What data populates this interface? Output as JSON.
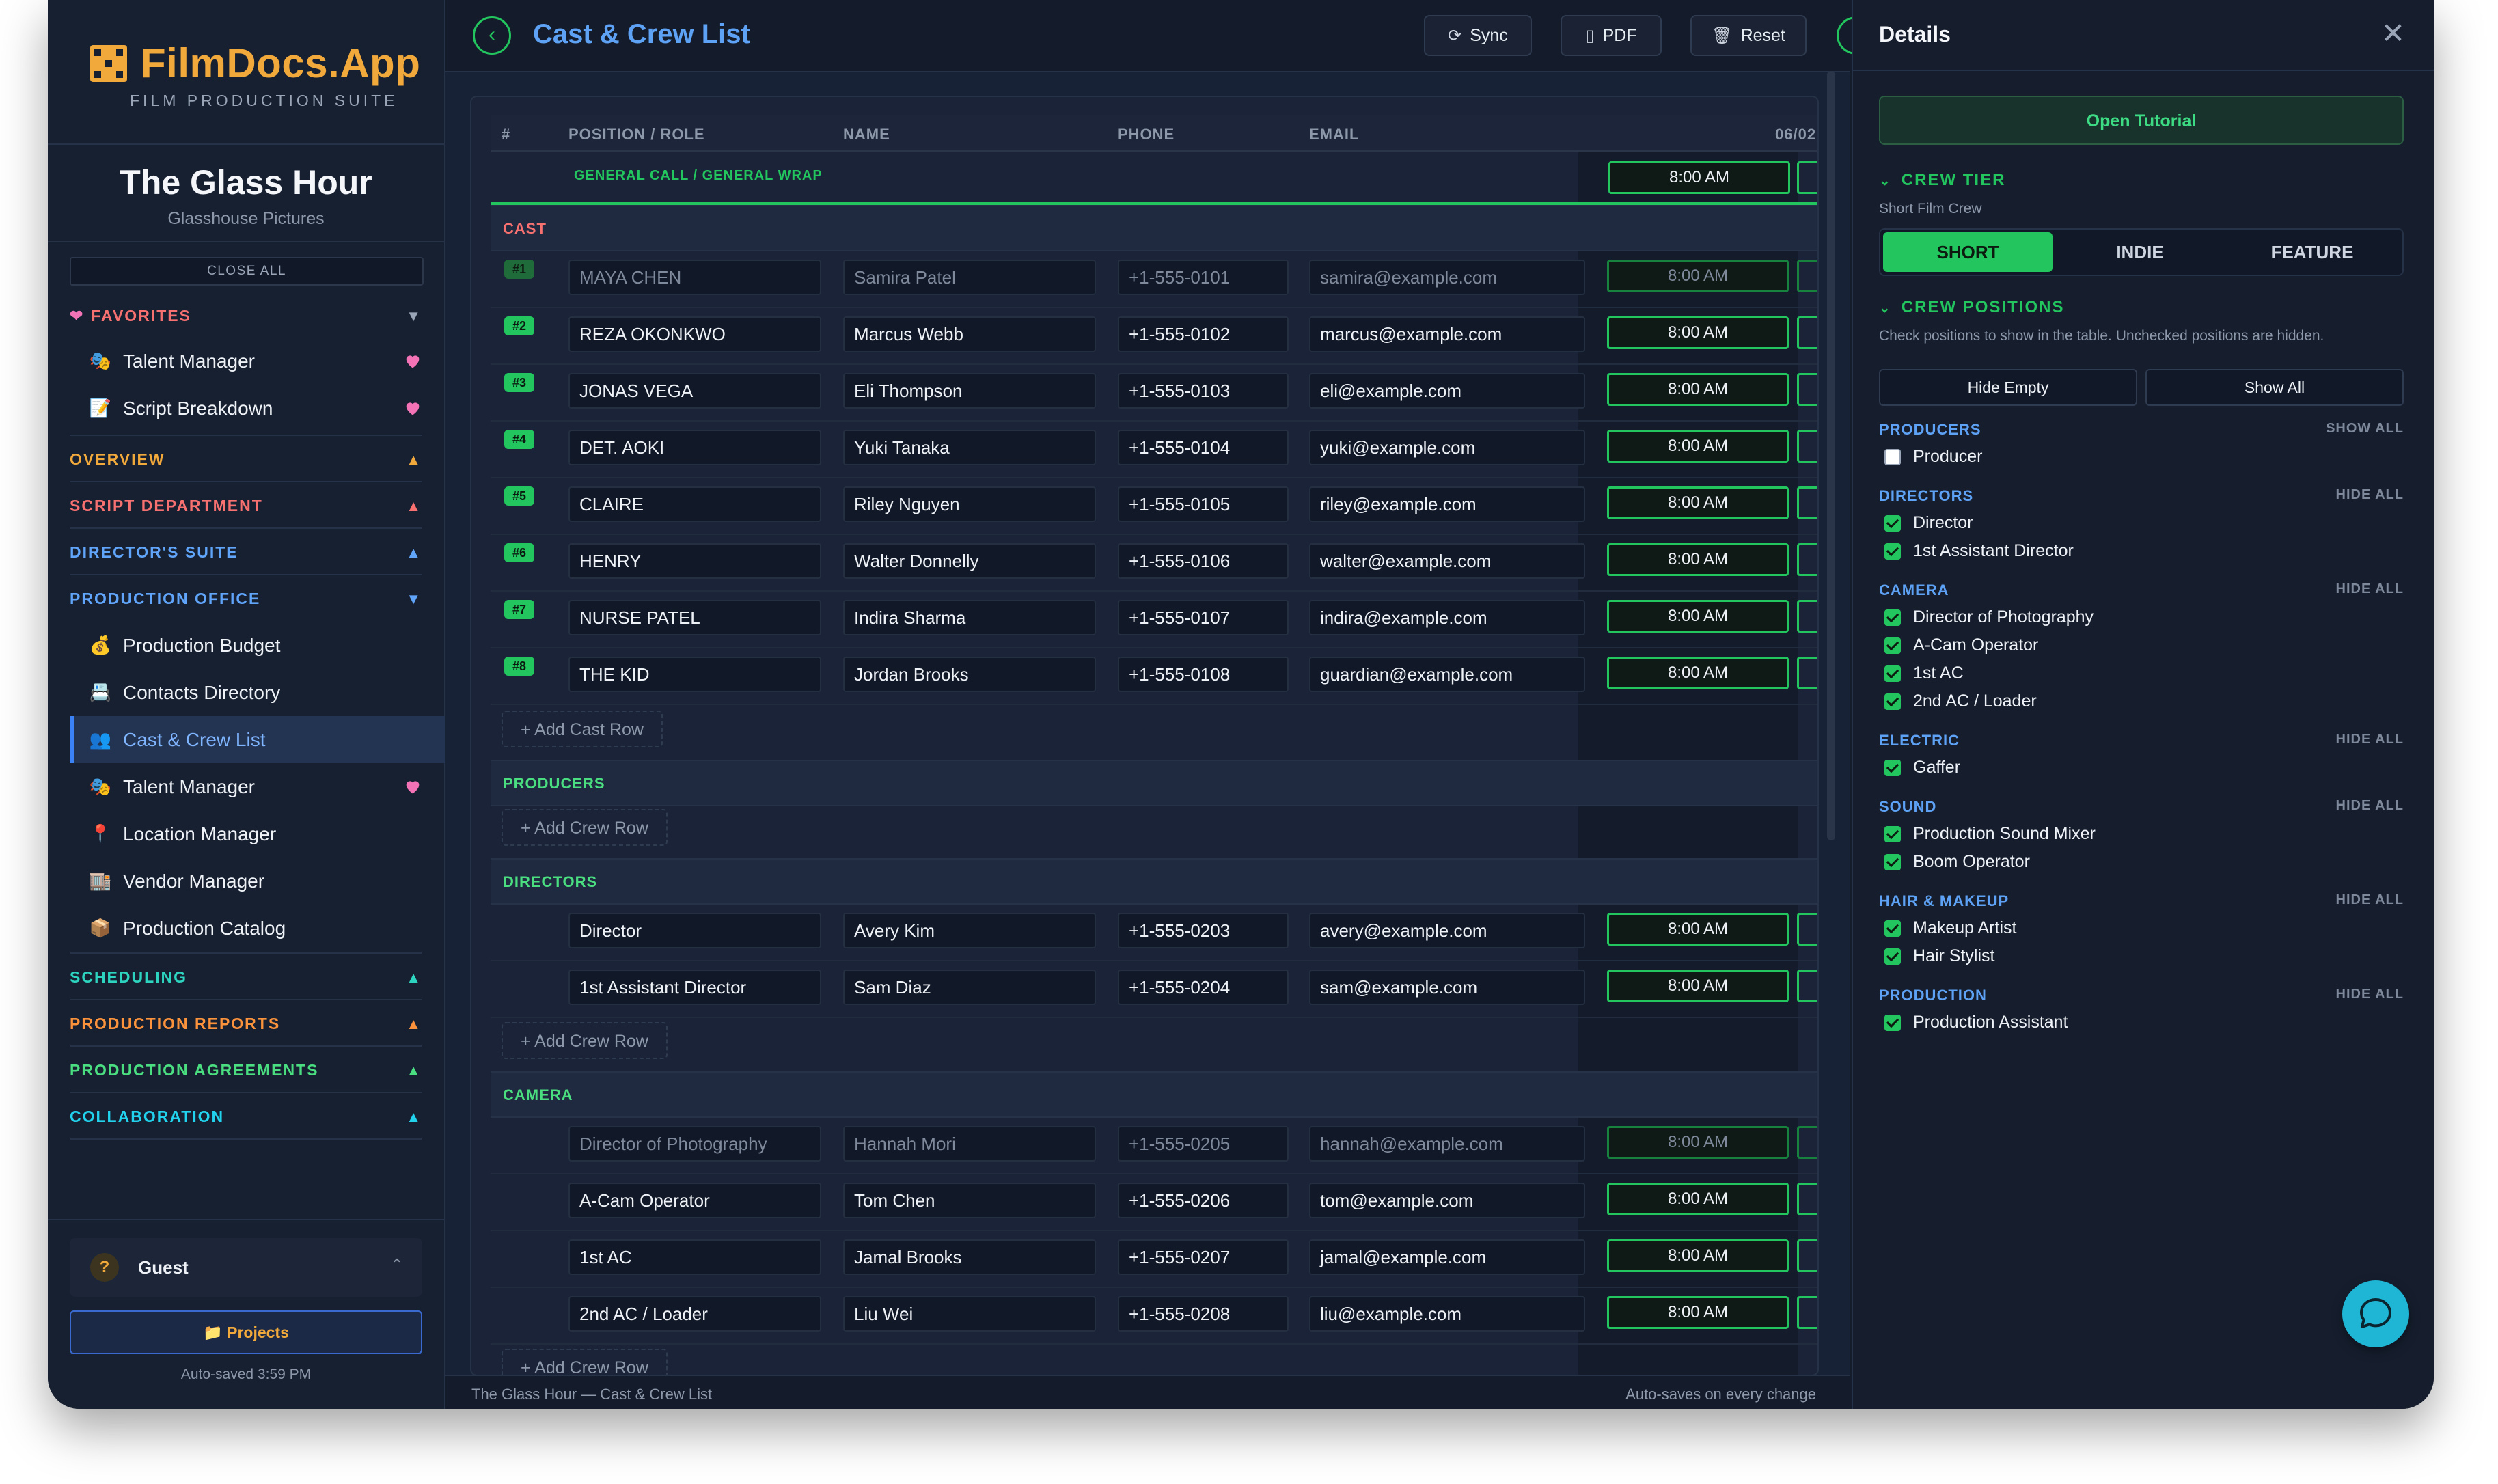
{
  "app": {
    "name": "FilmDocs.App",
    "tagline": "FILM PRODUCTION SUITE"
  },
  "project": {
    "title": "The Glass Hour",
    "company": "Glasshouse Pictures",
    "close_all": "CLOSE ALL"
  },
  "sidebar": {
    "favorites_label": "FAVORITES",
    "favorites": [
      {
        "label": "Talent Manager",
        "icon": "🎭"
      },
      {
        "label": "Script Breakdown",
        "icon": "📝"
      }
    ],
    "sections": [
      {
        "label": "OVERVIEW",
        "color": "#f2a93b"
      },
      {
        "label": "SCRIPT DEPARTMENT",
        "color": "#f87171"
      },
      {
        "label": "DIRECTOR'S SUITE",
        "color": "#60a5fa"
      },
      {
        "label": "PRODUCTION OFFICE",
        "color": "#60a5fa"
      },
      {
        "label": "SCHEDULING",
        "color": "#2dd4bf"
      },
      {
        "label": "PRODUCTION REPORTS",
        "color": "#fb923c"
      },
      {
        "label": "PRODUCTION AGREEMENTS",
        "color": "#4ade80"
      },
      {
        "label": "COLLABORATION",
        "color": "#22d3ee"
      }
    ],
    "office_items": [
      {
        "label": "Production Budget",
        "icon": "💰"
      },
      {
        "label": "Contacts Directory",
        "icon": "📇"
      },
      {
        "label": "Cast & Crew List",
        "icon": "👥"
      },
      {
        "label": "Talent Manager",
        "icon": "🎭"
      },
      {
        "label": "Location Manager",
        "icon": "📍"
      },
      {
        "label": "Vendor Manager",
        "icon": "🏬"
      },
      {
        "label": "Production Catalog",
        "icon": "📦"
      }
    ],
    "user": {
      "initial": "?",
      "name": "Guest"
    },
    "projects_label": "📁 Projects",
    "autosaved": "Auto-saved 3:59 PM"
  },
  "toolbar": {
    "title": "Cast & Crew List",
    "sync": "Sync",
    "pdf": "PDF",
    "reset": "Reset"
  },
  "table": {
    "headers": {
      "num": "#",
      "role": "POSITION / ROLE",
      "name": "NAME",
      "phone": "PHONE",
      "email": "EMAIL",
      "date": "06/02"
    },
    "general_call": {
      "label": "GENERAL CALL / GENERAL WRAP",
      "time": "8:00 AM"
    },
    "cast_label": "CAST",
    "cast": [
      {
        "num": "#1",
        "role": "MAYA CHEN",
        "name": "Samira Patel",
        "phone": "+1-555-0101",
        "email": "samira@example.com",
        "time": "8:00 AM",
        "dim": true
      },
      {
        "num": "#2",
        "role": "REZA OKONKWO",
        "name": "Marcus Webb",
        "phone": "+1-555-0102",
        "email": "marcus@example.com",
        "time": "8:00 AM"
      },
      {
        "num": "#3",
        "role": "JONAS VEGA",
        "name": "Eli Thompson",
        "phone": "+1-555-0103",
        "email": "eli@example.com",
        "time": "8:00 AM"
      },
      {
        "num": "#4",
        "role": "DET. AOKI",
        "name": "Yuki Tanaka",
        "phone": "+1-555-0104",
        "email": "yuki@example.com",
        "time": "8:00 AM"
      },
      {
        "num": "#5",
        "role": "CLAIRE",
        "name": "Riley Nguyen",
        "phone": "+1-555-0105",
        "email": "riley@example.com",
        "time": "8:00 AM"
      },
      {
        "num": "#6",
        "role": "HENRY",
        "name": "Walter Donnelly",
        "phone": "+1-555-0106",
        "email": "walter@example.com",
        "time": "8:00 AM"
      },
      {
        "num": "#7",
        "role": "NURSE PATEL",
        "name": "Indira Sharma",
        "phone": "+1-555-0107",
        "email": "indira@example.com",
        "time": "8:00 AM"
      },
      {
        "num": "#8",
        "role": "THE KID",
        "name": "Jordan Brooks",
        "phone": "+1-555-0108",
        "email": "guardian@example.com",
        "time": "8:00 AM"
      }
    ],
    "add_cast": "+ Add Cast Row",
    "add_crew": "+ Add Crew Row",
    "producers_label": "PRODUCERS",
    "directors_label": "DIRECTORS",
    "directors": [
      {
        "role": "Director",
        "name": "Avery Kim",
        "phone": "+1-555-0203",
        "email": "avery@example.com",
        "time": "8:00 AM"
      },
      {
        "role": "1st Assistant Director",
        "name": "Sam Diaz",
        "phone": "+1-555-0204",
        "email": "sam@example.com",
        "time": "8:00 AM"
      }
    ],
    "camera_label": "CAMERA",
    "camera": [
      {
        "role": "Director of Photography",
        "name": "Hannah Mori",
        "phone": "+1-555-0205",
        "email": "hannah@example.com",
        "time": "8:00 AM",
        "dim": true
      },
      {
        "role": "A-Cam Operator",
        "name": "Tom Chen",
        "phone": "+1-555-0206",
        "email": "tom@example.com",
        "time": "8:00 AM"
      },
      {
        "role": "1st AC",
        "name": "Jamal Brooks",
        "phone": "+1-555-0207",
        "email": "jamal@example.com",
        "time": "8:00 AM"
      },
      {
        "role": "2nd AC / Loader",
        "name": "Liu Wei",
        "phone": "+1-555-0208",
        "email": "liu@example.com",
        "time": "8:00 AM"
      }
    ]
  },
  "footer": {
    "left": "The Glass Hour — Cast & Crew List",
    "right": "Auto-saves on every change"
  },
  "details": {
    "title": "Details",
    "tutorial": "Open Tutorial",
    "tier_label": "CREW TIER",
    "tier_help": "Short Film Crew",
    "tiers": [
      "SHORT",
      "INDIE",
      "FEATURE"
    ],
    "positions_label": "CREW POSITIONS",
    "positions_help": "Check positions to show in the table. Unchecked positions are hidden.",
    "hide_empty": "Hide Empty",
    "show_all": "Show All",
    "groups": [
      {
        "name": "PRODUCERS",
        "action": "SHOW ALL",
        "items": [
          {
            "label": "Producer",
            "checked": false
          }
        ]
      },
      {
        "name": "DIRECTORS",
        "action": "HIDE ALL",
        "items": [
          {
            "label": "Director",
            "checked": true
          },
          {
            "label": "1st Assistant Director",
            "checked": true
          }
        ]
      },
      {
        "name": "CAMERA",
        "action": "HIDE ALL",
        "items": [
          {
            "label": "Director of Photography",
            "checked": true
          },
          {
            "label": "A-Cam Operator",
            "checked": true
          },
          {
            "label": "1st AC",
            "checked": true
          },
          {
            "label": "2nd AC / Loader",
            "checked": true
          }
        ]
      },
      {
        "name": "ELECTRIC",
        "action": "HIDE ALL",
        "items": [
          {
            "label": "Gaffer",
            "checked": true
          }
        ]
      },
      {
        "name": "SOUND",
        "action": "HIDE ALL",
        "items": [
          {
            "label": "Production Sound Mixer",
            "checked": true
          },
          {
            "label": "Boom Operator",
            "checked": true
          }
        ]
      },
      {
        "name": "HAIR & MAKEUP",
        "action": "HIDE ALL",
        "items": [
          {
            "label": "Makeup Artist",
            "checked": true
          },
          {
            "label": "Hair Stylist",
            "checked": true
          }
        ]
      },
      {
        "name": "PRODUCTION",
        "action": "HIDE ALL",
        "items": [
          {
            "label": "Production Assistant",
            "checked": true
          }
        ]
      }
    ]
  }
}
